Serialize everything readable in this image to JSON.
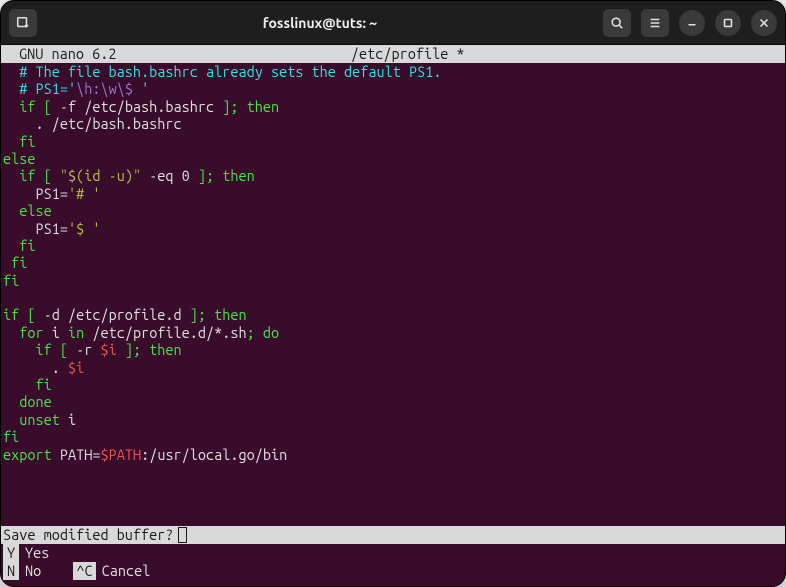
{
  "titlebar": {
    "title": "fosslinux@tuts: ~"
  },
  "nano": {
    "version": "GNU nano 6.2",
    "filename": "/etc/profile *"
  },
  "code": [
    [
      {
        "c": "c-cyan",
        "t": "  # The file bash.bashrc already sets the default PS1."
      }
    ],
    [
      {
        "c": "c-cyan",
        "t": "  # PS1='"
      },
      {
        "c": "c-purple",
        "t": "\\h:\\w\\$ "
      },
      {
        "c": "c-cyan",
        "t": "'"
      }
    ],
    [
      {
        "c": "c-green",
        "t": "  if ["
      },
      {
        "c": "c-default",
        "t": " -f /etc/bash.bashrc "
      },
      {
        "c": "c-green",
        "t": "]; then"
      }
    ],
    [
      {
        "c": "c-default",
        "t": "    . /etc/bash.bashrc"
      }
    ],
    [
      {
        "c": "c-green",
        "t": "  fi"
      }
    ],
    [
      {
        "c": "c-green",
        "t": "else"
      }
    ],
    [
      {
        "c": "c-green",
        "t": "  if ["
      },
      {
        "c": "c-default",
        "t": " "
      },
      {
        "c": "c-string",
        "t": "\"$(id -u)\""
      },
      {
        "c": "c-default",
        "t": " -eq 0 "
      },
      {
        "c": "c-green",
        "t": "]; then"
      }
    ],
    [
      {
        "c": "c-default",
        "t": "    PS1="
      },
      {
        "c": "c-string",
        "t": "'# '"
      }
    ],
    [
      {
        "c": "c-green",
        "t": "  else"
      }
    ],
    [
      {
        "c": "c-default",
        "t": "    PS1="
      },
      {
        "c": "c-string",
        "t": "'$ '"
      }
    ],
    [
      {
        "c": "c-green",
        "t": "  fi"
      }
    ],
    [
      {
        "c": "c-green",
        "t": " fi"
      }
    ],
    [
      {
        "c": "c-green",
        "t": "fi"
      }
    ],
    [
      {
        "c": "c-default",
        "t": " "
      }
    ],
    [
      {
        "c": "c-green",
        "t": "if ["
      },
      {
        "c": "c-default",
        "t": " -d /etc/profile.d "
      },
      {
        "c": "c-green",
        "t": "]; then"
      }
    ],
    [
      {
        "c": "c-green",
        "t": "  for"
      },
      {
        "c": "c-default",
        "t": " i "
      },
      {
        "c": "c-green",
        "t": "in"
      },
      {
        "c": "c-default",
        "t": " /etc/profile.d/*.sh"
      },
      {
        "c": "c-green",
        "t": "; do"
      }
    ],
    [
      {
        "c": "c-green",
        "t": "    if ["
      },
      {
        "c": "c-default",
        "t": " -r "
      },
      {
        "c": "c-red",
        "t": "$i"
      },
      {
        "c": "c-default",
        "t": " "
      },
      {
        "c": "c-green",
        "t": "]; then"
      }
    ],
    [
      {
        "c": "c-default",
        "t": "      . "
      },
      {
        "c": "c-red",
        "t": "$i"
      }
    ],
    [
      {
        "c": "c-green",
        "t": "    fi"
      }
    ],
    [
      {
        "c": "c-green",
        "t": "  done"
      }
    ],
    [
      {
        "c": "c-green",
        "t": "  unset"
      },
      {
        "c": "c-default",
        "t": " i"
      }
    ],
    [
      {
        "c": "c-green",
        "t": "fi"
      }
    ],
    [
      {
        "c": "c-green",
        "t": "export"
      },
      {
        "c": "c-default",
        "t": " PATH="
      },
      {
        "c": "c-red",
        "t": "$PATH"
      },
      {
        "c": "c-default",
        "t": ":/usr/local.go/bin"
      }
    ]
  ],
  "prompt": {
    "text": "Save modified buffer?"
  },
  "footer": {
    "col1": [
      {
        "key": " Y",
        "label": "Yes"
      },
      {
        "key": " N",
        "label": "No"
      }
    ],
    "col2": [
      {
        "key": "",
        "label": ""
      },
      {
        "key": "^C",
        "label": "Cancel"
      }
    ]
  }
}
